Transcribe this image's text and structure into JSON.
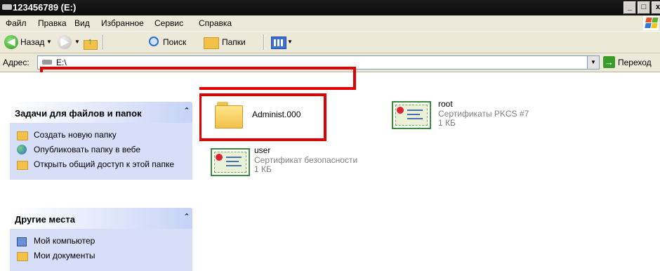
{
  "window": {
    "title": "123456789 (E:)",
    "buttons": [
      "_",
      "□",
      "x"
    ]
  },
  "menu": {
    "items": [
      "Файл",
      "Правка",
      "Вид",
      "Избранное",
      "Сервис",
      "Справка"
    ]
  },
  "toolbar": {
    "back_label": "Назад",
    "search_label": "Поиск",
    "folders_label": "Папки"
  },
  "address": {
    "label": "Адрес:",
    "value": "E:\\",
    "go_label": "Переход"
  },
  "tasks_panel": {
    "title": "Задачи для файлов и папок",
    "items": [
      {
        "label": "Создать новую папку",
        "icon": "new-folder-icon"
      },
      {
        "label": "Опубликовать папку в вебе",
        "icon": "globe-icon"
      },
      {
        "label": "Открыть общий доступ к этой папке",
        "icon": "share-folder-icon"
      }
    ]
  },
  "places_panel": {
    "title": "Другие места",
    "items": [
      {
        "label": "Мой компьютер",
        "icon": "computer-icon"
      },
      {
        "label": "Мои документы",
        "icon": "documents-icon"
      }
    ]
  },
  "files": [
    {
      "name": "Administ.000",
      "type": "",
      "size": "",
      "icon": "folder-icon"
    },
    {
      "name": "root",
      "type": "Сертификаты PKCS #7",
      "size": "1 КБ",
      "icon": "certificate-icon"
    },
    {
      "name": "user",
      "type": "Сертификат безопасности",
      "size": "1 КБ",
      "icon": "certificate-icon"
    }
  ],
  "colors": {
    "highlight": "#e00000",
    "panel_bg": "#d6dff7",
    "toolbar_bg": "#ece9d8"
  }
}
